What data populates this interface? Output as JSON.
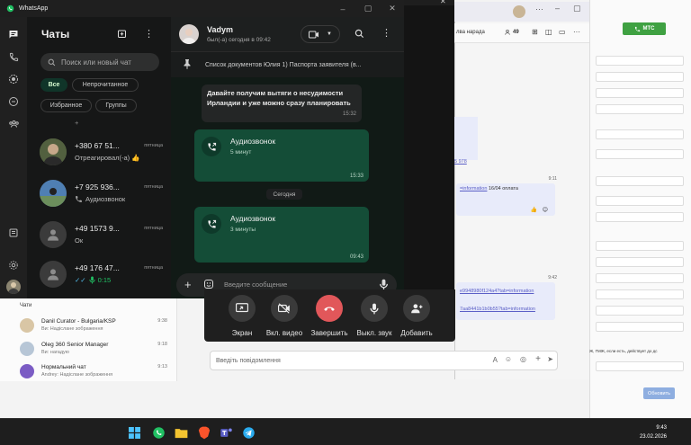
{
  "whatsapp": {
    "window_title": "WhatsApp",
    "list_title": "Чаты",
    "search_placeholder": "Поиск или новый чат",
    "filters": [
      "Все",
      "Непрочитанное",
      "Избранное",
      "Группы"
    ],
    "chats": [
      {
        "name": "",
        "time": "",
        "message": "+"
      },
      {
        "name": "+380 67 51...",
        "time": "пятница",
        "message": "Отреагировал(-а) 👍"
      },
      {
        "name": "+7 925 936...",
        "time": "пятница",
        "message": "Аудиозвонок"
      },
      {
        "name": "+49 1573 9...",
        "time": "пятница",
        "message": "Ок"
      },
      {
        "name": "+49 176 47...",
        "time": "пятница",
        "message": "0:15"
      }
    ],
    "conversation": {
      "contact_name": "Vadym",
      "status": "был(-а) сегодня в 09:42",
      "pinned": "Список документов Юлия 1) Паспорта заявителя (в...",
      "messages": [
        {
          "text": "Давайте получим вытяги о несудимости Ирландии и уже можно сразу планировать",
          "time": "15:32"
        },
        {
          "title": "Аудиозвонок",
          "sub": "5 минут",
          "time": "15:33"
        },
        {
          "title": "Аудиозвонок",
          "sub": "3 минуты",
          "time": "09:43"
        }
      ],
      "date_separator": "Сегодня",
      "composer_placeholder": "Введите сообщение"
    }
  },
  "call_controls": [
    {
      "label": "Экран"
    },
    {
      "label": "Вкл. видео"
    },
    {
      "label": "Завершить"
    },
    {
      "label": "Выкл. звук"
    },
    {
      "label": "Добавить"
    }
  ],
  "teams": {
    "meeting_label": "лва нарада",
    "participants": "49",
    "messages": [
      {
        "time": "9:11",
        "link": "=information",
        "text": " 16/04 оплата"
      },
      {
        "time": "9:42",
        "link1": "e9948980f124a4?tab=information",
        "link2": "7aa8441b1b0b55?tab=information"
      }
    ],
    "partial_number": "5 978",
    "input_placeholder": "Введіть повідомлення",
    "chats_header": "Чати",
    "chats": [
      {
        "name": "Danil Curator - Bulgaria/KSP",
        "sub": "Ви: Надіслане зображення",
        "time": "9:38"
      },
      {
        "name": "Oleg 360 Senior Manager",
        "sub": "Ви: нагадую",
        "time": "9:18"
      },
      {
        "name": "Нормальний чат",
        "sub": "Andrey: Надіслане зображення",
        "time": "9:13"
      }
    ]
  },
  "crm": {
    "call_button": "МТС",
    "update_button": "Обновить",
    "notice": "Ж, ГМЖ, если есть, действует до дс",
    "overlay_text": "на"
  },
  "taskbar": {
    "time": "9:43",
    "date": "23.02.2026"
  },
  "colors": {
    "wa_accent": "#21c063",
    "wa_outgoing": "#144d37",
    "end_call": "#e1575a",
    "teams_accent": "#5b5fc7",
    "crm_green": "#3fa142"
  }
}
